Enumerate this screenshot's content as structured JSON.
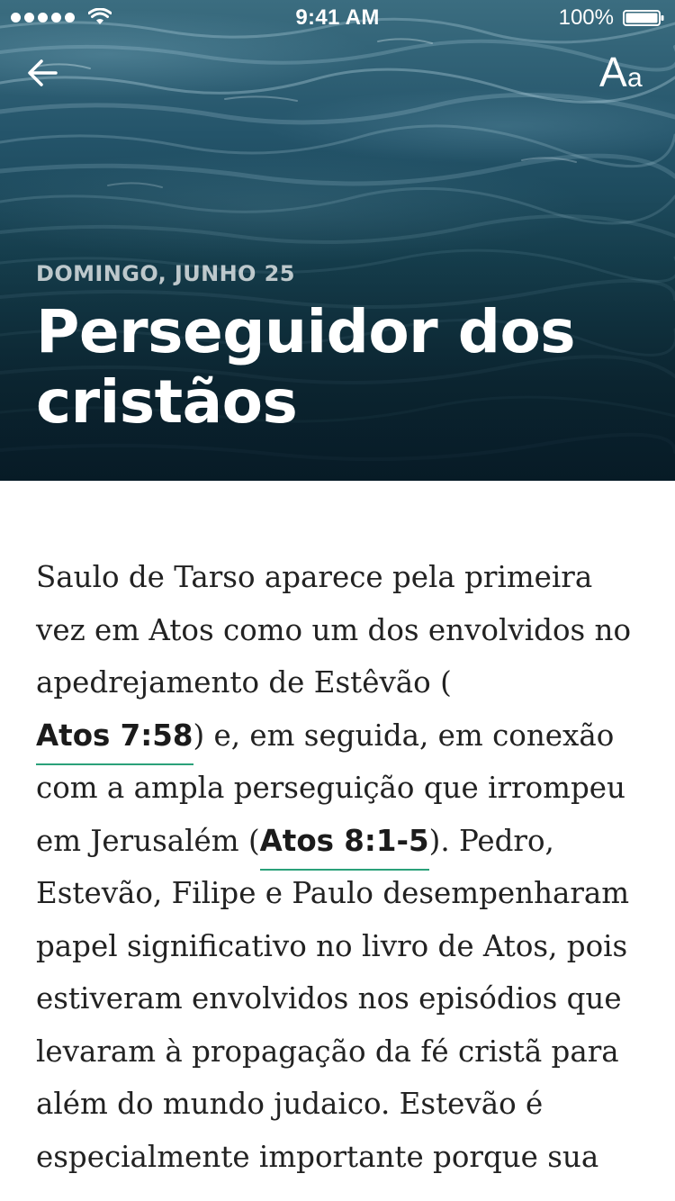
{
  "status_bar": {
    "time": "9:41 AM",
    "battery_percent": "100%"
  },
  "header": {
    "back_icon": "arrow-left-icon",
    "font_settings": {
      "icon": "font-size-icon",
      "big_letter": "A",
      "small_letter": "a"
    }
  },
  "article": {
    "date": "DOMINGO, JUNHO 25",
    "title": "Perseguidor dos cristãos",
    "body": {
      "text_1": "Saulo de Tarso aparece pela primeira vez em Atos como um dos envolvidos no apedrejamento de Estêvão (",
      "ref_1": "Atos 7:58",
      "text_2": ") e, em seguida, em conexão com a ampla perseguição que irrompeu em Jerusalém (",
      "ref_2": "Atos 8:1-5",
      "text_3": "). Pedro, Estevão, Filipe e Paulo desempenharam papel significativo no livro de Atos, pois estiveram envolvidos nos episódios que levaram à propagação da fé cristã para além do mundo judaico. Estevão é especialmente importante porque sua"
    }
  },
  "colors": {
    "link_underline": "#2aa17a",
    "hero_dark": "#0e2c38",
    "hero_light": "#3b6d80",
    "text": "#222222"
  }
}
